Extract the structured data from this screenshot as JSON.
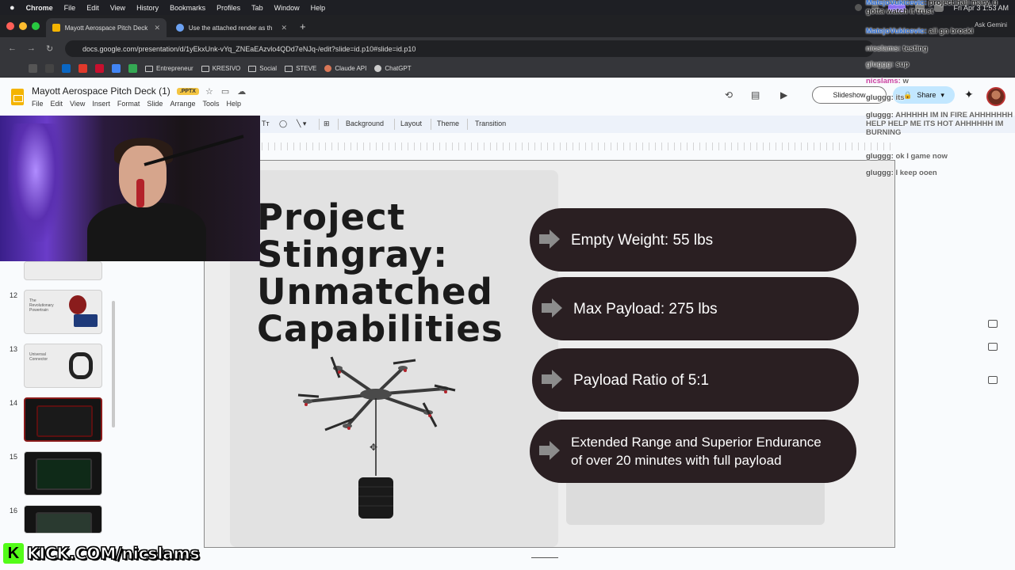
{
  "mac_menubar": {
    "app_name": "Chrome",
    "items": [
      "File",
      "Edit",
      "View",
      "History",
      "Bookmarks",
      "Profiles",
      "Tab",
      "Window",
      "Help"
    ],
    "datetime": "Fri Apr 3  1:53 AM"
  },
  "browser": {
    "tabs": [
      {
        "title": "Mayott Aerospace Pitch Deck",
        "active": true
      },
      {
        "title": "Use the attached render as th",
        "active": false
      }
    ],
    "ask_gemini": "Ask Gemini",
    "url": "docs.google.com/presentation/d/1yEkxUnk-vYq_ZNEaEAzvlo4QDd7eNJq-/edit?slide=id.p10#slide=id.p10",
    "bookmarks": [
      "Entrepreneur",
      "KRESIVO",
      "Social",
      "STEVE",
      "Claude API",
      "ChatGPT"
    ]
  },
  "docs": {
    "title": "Mayott Aerospace Pitch Deck (1)",
    "badge": ".PPTX",
    "menu": [
      "File",
      "Edit",
      "View",
      "Insert",
      "Format",
      "Slide",
      "Arrange",
      "Tools",
      "Help"
    ],
    "slideshow_label": "Slideshow",
    "share_label": "Share",
    "toolbar": [
      "Background",
      "Layout",
      "Theme",
      "Transition"
    ]
  },
  "filmstrip": {
    "numbers": [
      "12",
      "13",
      "14",
      "15",
      "16"
    ],
    "thumb12_text": "The Revolutionary Powertrain",
    "thumb13_text": "Universal Connector"
  },
  "slide": {
    "title": "Project Stingray: Unmatched Capabilities",
    "bullets": [
      "Empty Weight: 55 lbs",
      "Max Payload: 275 lbs",
      "Payload Ratio of 5:1",
      "Extended Range and Superior Endurance of over 20 minutes with full payload"
    ]
  },
  "chat": {
    "messages": [
      {
        "user": "MatejoVukicevic:",
        "text": "project hail mary, u gotta watch it trust"
      },
      {
        "user": "MatejoVukicevic:",
        "text": "aii gn broski"
      },
      {
        "user": "nicslams:",
        "text": "testing"
      },
      {
        "user": "gluggg:",
        "text": "sup"
      },
      {
        "user": "nicslams:",
        "text": "w"
      },
      {
        "user": "gluggg:",
        "text": "its"
      },
      {
        "user": "gluggg:",
        "text": "AHHHHH IM IN FIRE AHHHHHHH HELP HELP ME ITS HOT AHHHHHH IM BURNING"
      },
      {
        "user": "gluggg:",
        "text": "ok I game now"
      },
      {
        "user": "gluggg:",
        "text": "I keep ooen"
      }
    ]
  },
  "watermark": "KICK.COM/nicslams",
  "colors": {
    "pill_bg": "#2a1f22",
    "kick_green": "#53fc18",
    "share_bg": "#c2e7ff"
  }
}
